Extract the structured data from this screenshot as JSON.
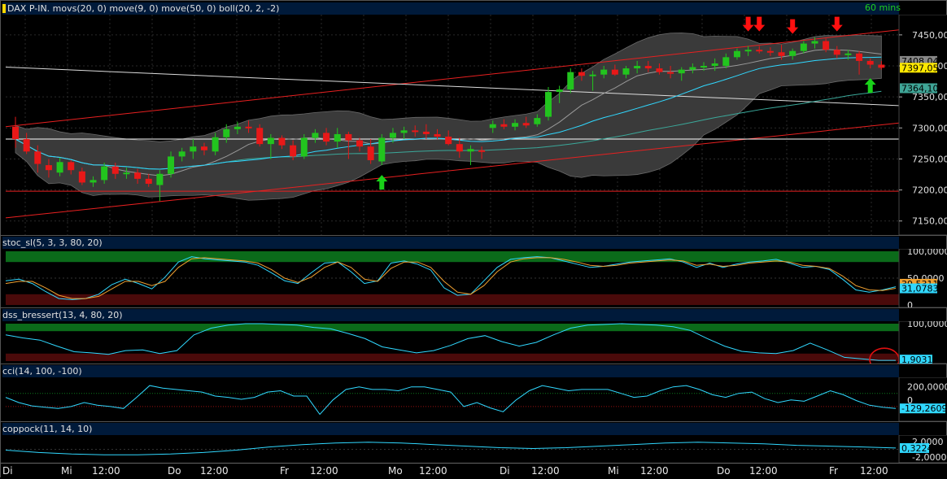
{
  "colors": {
    "background": "#000000",
    "bull": "#22c41e",
    "bear": "#e81818",
    "bollinger_band": "#3a3a3a",
    "mov20": "#30d8ff",
    "mov9": "#999999",
    "mov50": "#3aa89a",
    "trend_line": "#e82020",
    "hline": "#ffffff",
    "stoc_fast": "#30d8ff",
    "stoc_slow": "#f0a030",
    "zone_green": "#0b6b1a",
    "zone_red": "#4a0a0a",
    "indicator_line": "#30d8ff",
    "annotation": "#e01010"
  },
  "panels": {
    "price": {
      "title": "DAX P-IN. movs(20, 0) move(9, 0) move(50, 0) boll(20, 2, -2)",
      "timeframe": "60 mins",
      "ticks": [
        "7450,00",
        "7400,00",
        "7350,00",
        "7300,00",
        "7250,00",
        "7200,00",
        "7150,00"
      ],
      "labels": [
        "7408,04",
        "7397,05",
        "7364,10"
      ]
    },
    "stoc": {
      "title": "stoc_sl(5, 3, 3, 80, 20)",
      "ticks": [
        "100,0000",
        "50,0000",
        "0"
      ],
      "labels": [
        "31,0783",
        "39,5311"
      ]
    },
    "dss": {
      "title": "dss_bressert(13, 4, 80, 20)",
      "ticks": [
        "100,0000",
        "0"
      ],
      "labels": [
        "1,9031"
      ]
    },
    "cci": {
      "title": "cci(14, 100, -100)",
      "ticks": [
        "200,0000",
        "0"
      ],
      "labels": [
        "-129,2609"
      ]
    },
    "coppock": {
      "title": "coppock(11, 14, 10)",
      "ticks": [
        "2,0000",
        "-2,0000"
      ],
      "labels": [
        "0,3224"
      ]
    }
  },
  "time_axis": [
    {
      "label": "Di"
    },
    {
      "label": "Mi"
    },
    {
      "label": "12:00"
    },
    {
      "label": "Do"
    },
    {
      "label": "12:00"
    },
    {
      "label": "Fr"
    },
    {
      "label": "12:00"
    },
    {
      "label": "Mo"
    },
    {
      "label": "12:00"
    },
    {
      "label": "Di"
    },
    {
      "label": "12:00"
    },
    {
      "label": "Mi"
    },
    {
      "label": "12:00"
    },
    {
      "label": "Do"
    },
    {
      "label": "12:00"
    },
    {
      "label": "Fr"
    },
    {
      "label": "12:00"
    }
  ],
  "chart_data": [
    {
      "type": "candlestick",
      "name": "DAX P-IN. 60 mins",
      "ylim": [
        7130,
        7480
      ],
      "ohlc": [
        [
          7302,
          7318,
          7268,
          7282
        ],
        [
          7282,
          7292,
          7258,
          7262
        ],
        [
          7262,
          7272,
          7228,
          7242
        ],
        [
          7240,
          7250,
          7220,
          7232
        ],
        [
          7228,
          7252,
          7222,
          7245
        ],
        [
          7245,
          7248,
          7225,
          7232
        ],
        [
          7230,
          7236,
          7208,
          7212
        ],
        [
          7212,
          7222,
          7205,
          7216
        ],
        [
          7216,
          7244,
          7210,
          7238
        ],
        [
          7238,
          7244,
          7218,
          7226
        ],
        [
          7226,
          7236,
          7218,
          7228
        ],
        [
          7228,
          7234,
          7210,
          7218
        ],
        [
          7218,
          7226,
          7205,
          7210
        ],
        [
          7208,
          7232,
          7182,
          7226
        ],
        [
          7226,
          7262,
          7220,
          7254
        ],
        [
          7254,
          7268,
          7246,
          7262
        ],
        [
          7262,
          7282,
          7250,
          7270
        ],
        [
          7270,
          7276,
          7256,
          7264
        ],
        [
          7262,
          7292,
          7256,
          7285
        ],
        [
          7285,
          7306,
          7276,
          7298
        ],
        [
          7298,
          7310,
          7290,
          7302
        ],
        [
          7302,
          7312,
          7292,
          7300
        ],
        [
          7300,
          7306,
          7270,
          7274
        ],
        [
          7274,
          7290,
          7250,
          7284
        ],
        [
          7284,
          7288,
          7266,
          7272
        ],
        [
          7272,
          7280,
          7248,
          7254
        ],
        [
          7254,
          7290,
          7250,
          7284
        ],
        [
          7284,
          7298,
          7276,
          7292
        ],
        [
          7292,
          7300,
          7272,
          7278
        ],
        [
          7278,
          7300,
          7268,
          7290
        ],
        [
          7290,
          7294,
          7250,
          7280
        ],
        [
          7280,
          7284,
          7262,
          7270
        ],
        [
          7270,
          7282,
          7242,
          7248
        ],
        [
          7246,
          7290,
          7240,
          7284
        ],
        [
          7284,
          7300,
          7276,
          7292
        ],
        [
          7292,
          7302,
          7282,
          7296
        ],
        [
          7296,
          7304,
          7286,
          7294
        ],
        [
          7294,
          7306,
          7282,
          7290
        ],
        [
          7290,
          7298,
          7282,
          7286
        ],
        [
          7286,
          7296,
          7272,
          7274
        ],
        [
          7274,
          7284,
          7252,
          7262
        ],
        [
          7262,
          7272,
          7240,
          7266
        ],
        [
          7264,
          7270,
          7250,
          7262
        ],
        [
          7300,
          7312,
          7292,
          7306
        ],
        [
          7306,
          7314,
          7298,
          7302
        ],
        [
          7302,
          7314,
          7296,
          7308
        ],
        [
          7308,
          7318,
          7300,
          7304
        ],
        [
          7306,
          7322,
          7302,
          7316
        ],
        [
          7318,
          7366,
          7312,
          7358
        ],
        [
          7358,
          7368,
          7340,
          7362
        ],
        [
          7362,
          7396,
          7356,
          7390
        ],
        [
          7390,
          7396,
          7376,
          7384
        ],
        [
          7384,
          7392,
          7360,
          7386
        ],
        [
          7386,
          7400,
          7380,
          7394
        ],
        [
          7394,
          7402,
          7384,
          7386
        ],
        [
          7386,
          7400,
          7380,
          7396
        ],
        [
          7396,
          7408,
          7388,
          7400
        ],
        [
          7400,
          7408,
          7390,
          7396
        ],
        [
          7396,
          7404,
          7386,
          7390
        ],
        [
          7390,
          7400,
          7380,
          7388
        ],
        [
          7388,
          7398,
          7376,
          7394
        ],
        [
          7394,
          7404,
          7388,
          7398
        ],
        [
          7398,
          7406,
          7392,
          7400
        ],
        [
          7400,
          7412,
          7392,
          7404
        ],
        [
          7400,
          7420,
          7396,
          7414
        ],
        [
          7414,
          7428,
          7410,
          7424
        ],
        [
          7424,
          7432,
          7416,
          7426
        ],
        [
          7426,
          7432,
          7420,
          7424
        ],
        [
          7424,
          7430,
          7416,
          7422
        ],
        [
          7422,
          7434,
          7410,
          7416
        ],
        [
          7416,
          7428,
          7410,
          7424
        ],
        [
          7424,
          7440,
          7420,
          7436
        ],
        [
          7436,
          7446,
          7428,
          7440
        ],
        [
          7440,
          7444,
          7422,
          7426
        ],
        [
          7426,
          7432,
          7412,
          7418
        ],
        [
          7418,
          7426,
          7410,
          7420
        ],
        [
          7420,
          7424,
          7386,
          7408
        ],
        [
          7408,
          7412,
          7396,
          7402
        ],
        [
          7402,
          7408,
          7394,
          7397
        ]
      ],
      "horizontal_levels": [
        7282,
        7198
      ],
      "signals": [
        {
          "dir": "up",
          "bar": 33
        },
        {
          "dir": "down",
          "bar": 66
        },
        {
          "dir": "down",
          "bar": 67
        },
        {
          "dir": "down",
          "bar": 70
        },
        {
          "dir": "down",
          "bar": 74
        },
        {
          "dir": "up",
          "bar": 77
        }
      ]
    },
    {
      "type": "line",
      "name": "stoc_sl",
      "ylim": [
        0,
        100
      ],
      "zones": [
        80,
        20
      ],
      "series": [
        {
          "name": "stoc fast",
          "values": [
            45,
            48,
            40,
            25,
            12,
            10,
            12,
            20,
            38,
            48,
            40,
            30,
            52,
            80,
            90,
            86,
            84,
            82,
            80,
            74,
            60,
            45,
            40,
            60,
            78,
            80,
            62,
            40,
            45,
            78,
            82,
            76,
            65,
            32,
            18,
            20,
            45,
            70,
            85,
            88,
            90,
            88,
            82,
            76,
            70,
            72,
            76,
            80,
            82,
            84,
            86,
            80,
            70,
            78,
            70,
            76,
            80,
            82,
            85,
            78,
            70,
            72,
            66,
            48,
            28,
            24,
            28,
            34
          ]
        },
        {
          "name": "stoc slow",
          "values": [
            40,
            44,
            44,
            32,
            18,
            12,
            12,
            16,
            30,
            44,
            44,
            36,
            44,
            70,
            86,
            88,
            86,
            84,
            82,
            78,
            66,
            50,
            42,
            52,
            70,
            80,
            70,
            48,
            44,
            68,
            80,
            80,
            70,
            44,
            24,
            20,
            36,
            62,
            80,
            86,
            88,
            88,
            85,
            80,
            74,
            72,
            74,
            78,
            80,
            82,
            84,
            82,
            74,
            76,
            72,
            74,
            78,
            80,
            82,
            80,
            74,
            72,
            68,
            54,
            36,
            28,
            27,
            31
          ]
        }
      ]
    },
    {
      "type": "line",
      "name": "dss_bressert",
      "ylim": [
        0,
        100
      ],
      "zones": [
        80,
        20
      ],
      "series": [
        {
          "name": "dss",
          "values": [
            70,
            62,
            56,
            40,
            25,
            22,
            18,
            28,
            30,
            20,
            28,
            70,
            88,
            96,
            100,
            100,
            98,
            96,
            90,
            86,
            74,
            60,
            38,
            30,
            22,
            28,
            42,
            60,
            68,
            52,
            40,
            50,
            70,
            88,
            96,
            98,
            100,
            98,
            96,
            92,
            82,
            60,
            40,
            26,
            22,
            20,
            28,
            48,
            30,
            10,
            6,
            2,
            2
          ]
        }
      ]
    },
    {
      "type": "line",
      "name": "cci",
      "ylim": [
        -300,
        320
      ],
      "series": [
        {
          "name": "cci",
          "values": [
            40,
            -40,
            -90,
            -110,
            -130,
            -100,
            -40,
            -80,
            -100,
            -130,
            40,
            220,
            180,
            160,
            140,
            120,
            60,
            40,
            10,
            40,
            120,
            140,
            60,
            60,
            -220,
            0,
            160,
            200,
            160,
            160,
            140,
            200,
            200,
            160,
            120,
            -100,
            -40,
            -120,
            -180,
            0,
            140,
            220,
            180,
            140,
            160,
            160,
            160,
            100,
            40,
            60,
            140,
            200,
            220,
            160,
            80,
            40,
            100,
            120,
            20,
            -40,
            0,
            -20,
            60,
            140,
            80,
            -10,
            -80,
            -110,
            -129
          ]
        }
      ]
    },
    {
      "type": "line",
      "name": "coppock",
      "ylim": [
        -3,
        3.2
      ],
      "series": [
        {
          "name": "coppock",
          "values": [
            -0.2,
            -0.8,
            -1.2,
            -1.4,
            -1.4,
            -1.2,
            -0.8,
            -0.2,
            0.6,
            1.2,
            1.6,
            1.8,
            1.6,
            1.2,
            0.8,
            0.4,
            0.2,
            0.4,
            0.8,
            1.2,
            1.6,
            1.8,
            1.6,
            1.4,
            1.0,
            0.8,
            0.6,
            0.32
          ]
        }
      ]
    }
  ]
}
